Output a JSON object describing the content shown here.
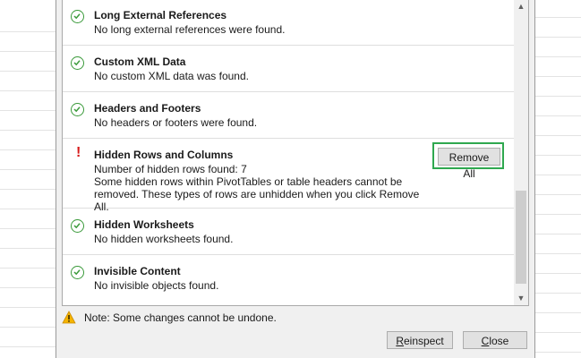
{
  "dialog": {
    "items": [
      {
        "status": "ok",
        "title": "Long External References",
        "desc": "No long external references were found."
      },
      {
        "status": "ok",
        "title": "Custom XML Data",
        "desc": "No custom XML data was found."
      },
      {
        "status": "ok",
        "title": "Headers and Footers",
        "desc": "No headers or footers were found."
      },
      {
        "status": "warning",
        "title": "Hidden Rows and Columns",
        "desc": "Number of hidden rows found: 7\nSome hidden rows within PivotTables or table headers cannot be\nremoved. These types of rows are unhidden when you click Remove All.",
        "action": "Remove All"
      },
      {
        "status": "ok",
        "title": "Hidden Worksheets",
        "desc": "No hidden worksheets found."
      },
      {
        "status": "ok",
        "title": "Invisible Content",
        "desc": "No invisible objects found."
      }
    ],
    "note": "Note: Some changes cannot be undone.",
    "buttons": {
      "reinspect_prefix": "R",
      "reinspect_rest": "einspect",
      "close_prefix": "C",
      "close_rest": "lose"
    },
    "colors": {
      "ok": "#3a9a3a",
      "warning": "#d71a1a",
      "highlight": "#2fa84f"
    }
  }
}
